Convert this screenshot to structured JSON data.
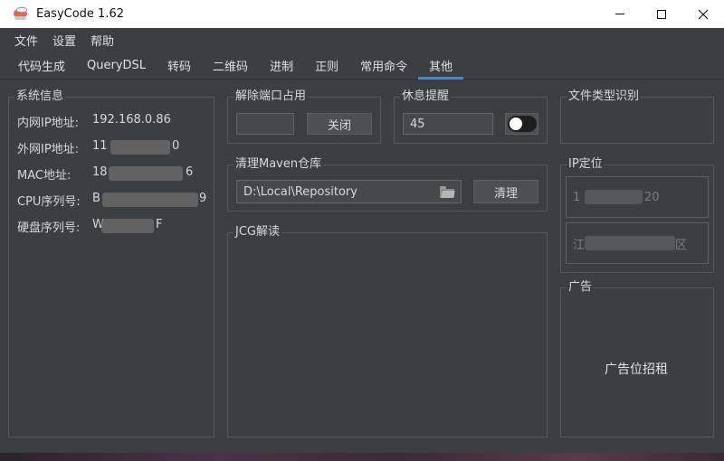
{
  "window": {
    "title": "EasyCode 1.62",
    "controls": [
      "minimize",
      "maximize",
      "close"
    ]
  },
  "menu": [
    "文件",
    "设置",
    "帮助"
  ],
  "tabs": [
    {
      "label": "代码生成",
      "active": false
    },
    {
      "label": "QueryDSL",
      "active": false
    },
    {
      "label": "转码",
      "active": false
    },
    {
      "label": "二维码",
      "active": false
    },
    {
      "label": "进制",
      "active": false
    },
    {
      "label": "正则",
      "active": false
    },
    {
      "label": "常用命令",
      "active": false
    },
    {
      "label": "其他",
      "active": true
    }
  ],
  "system_info": {
    "title": "系统信息",
    "rows": [
      {
        "label": "内网IP地址:",
        "value": "192.168.0.86"
      },
      {
        "label": "外网IP地址:",
        "value_start": "11",
        "value_end": "0"
      },
      {
        "label": "MAC地址:",
        "value_start": "18",
        "value_end": "6"
      },
      {
        "label": "CPU序列号:",
        "value_start": "B",
        "value_end": "9"
      },
      {
        "label": "硬盘序列号:",
        "value_start": "W",
        "value_end": "F"
      }
    ]
  },
  "port": {
    "title": "解除端口占用",
    "port_value": "",
    "close_button": "关闭"
  },
  "rest": {
    "title": "休息提醒",
    "minutes": "45",
    "toggle_on": false
  },
  "file_type": {
    "title": "文件类型识别"
  },
  "maven": {
    "title": "清理Maven仓库",
    "path": "D:\\Local\\Repository",
    "clean_button": "清理"
  },
  "jcg": {
    "title": "JCG解读"
  },
  "ip_location": {
    "title": "IP定位",
    "ip_start": "1",
    "ip_end": "20",
    "location_start": "江",
    "location_end": "区"
  },
  "ad": {
    "title": "广告",
    "text": "广告位招租"
  },
  "colors": {
    "accent": "#4a88c7",
    "panel_bg": "#3c3f41",
    "border": "#555759"
  }
}
